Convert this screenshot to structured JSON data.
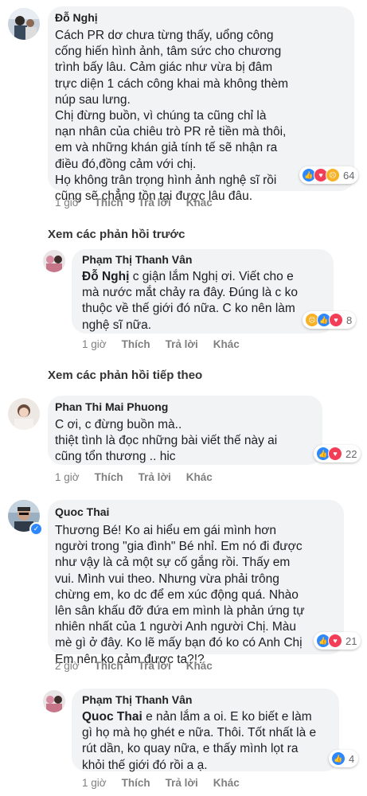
{
  "comments": [
    {
      "author": "Đỗ Nghị",
      "lines": [
        "Cách PR dơ chưa từng thấy, uổng công",
        "cống hiến hình ảnh, tâm sức cho chương",
        "trình bấy lâu. Cảm giác như vừa bị đâm",
        "trực diện 1 cách công khai mà không thèm",
        "núp sau lưng.",
        "Chị đừng buồn, vì chúng ta cũng chỉ là",
        "nạn nhân của chiêu trò PR rẻ tiền mà thôi,",
        "em và những khán giả tính tế sẽ nhận ra",
        "điều đó,đồng cảm với chị.",
        "Họ không trân trọng hình ảnh nghệ sĩ rồi",
        "cũng sẽ chẳng tồn tại được lâu đâu."
      ],
      "reactions": [
        "like",
        "love",
        "sad"
      ],
      "reaction_count": "64",
      "time": "1 giờ",
      "like": "Thích",
      "reply": "Trả lời",
      "other": "Khác"
    },
    {
      "author": "Phạm Thị Thanh Vân",
      "tag": "Đỗ Nghị",
      "line0_rest": " c giận lắm Nghị ơi. Viết cho e",
      "lines": [
        "mà nước mắt chảy ra đây. Đúng là c ko",
        "thuộc về thế giới đó nữa. C ko nên làm",
        "nghệ sĩ nữa."
      ],
      "reactions": [
        "sad",
        "like",
        "love"
      ],
      "reaction_count": "8",
      "time": "1 giờ",
      "like": "Thích",
      "reply": "Trả lời",
      "other": "Khác"
    },
    {
      "author": "Phan Thi Mai Phuong",
      "lines": [
        "C ơi, c đừng buồn mà..",
        "thiệt tình là đọc những bài viết thế này ai",
        "cũng tổn thương .. hic"
      ],
      "reactions": [
        "like",
        "love"
      ],
      "reaction_count": "22",
      "time": "1 giờ",
      "like": "Thích",
      "reply": "Trả lời",
      "other": "Khác"
    },
    {
      "author": "Quoc Thai",
      "lines": [
        "Thương Bé! Ko ai hiểu em gái mình hơn",
        "người trong \"gia đình\" Bé nhỉ. Em nó đi được",
        "như vậy là cả một sự cố gắng rồi. Thấy em",
        "vui. Mình vui theo. Nhưng vừa phải trông",
        "chừng em, ko dc để em xúc động quá. Nhào",
        "lên sân khấu đỡ đứa em mình là phản ứng tự",
        "nhiên nhất của 1 người Anh người Chị. Màu",
        "mè gì ở đây. Ko lẽ mấy bạn đó ko có Anh Chị",
        "Em nên ko cảm được ta?!?"
      ],
      "reactions": [
        "like",
        "love"
      ],
      "reaction_count": "21",
      "time": "2 giờ",
      "like": "Thích",
      "reply": "Trả lời",
      "other": "Khác"
    },
    {
      "author": "Phạm Thị Thanh Vân",
      "tag": "Quoc Thai",
      "line0_rest": " e nản lắm a oi. E ko biết e làm",
      "lines": [
        "gì họ mà họ ghét e nữa. Thôi. Tốt nhất là e",
        "rút dần, ko quay nữa, e thấy mình lọt ra",
        "khỏi thế giới đó rồi a ạ."
      ],
      "reactions": [
        "like"
      ],
      "reaction_count": "4",
      "time": "1 giờ",
      "like": "Thích",
      "reply": "Trả lời",
      "other": "Khác"
    }
  ],
  "links": {
    "previous_replies": "Xem các phản hồi trước",
    "next_replies": "Xem các phản hồi tiếp theo"
  },
  "icons": {
    "like": "thumbs-up-icon",
    "love": "heart-icon",
    "sad": "sad-face-icon",
    "verified": "check-badge-icon"
  },
  "colors": {
    "bubble": "#f2f3f5",
    "like": "#2d88ff",
    "love": "#f33e58",
    "sad": "#f7b125",
    "meta": "#7f7f7f"
  }
}
